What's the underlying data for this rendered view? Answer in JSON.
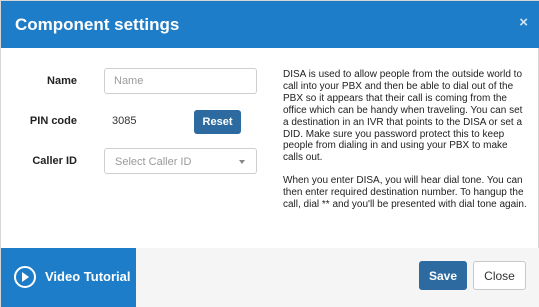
{
  "dialog": {
    "title": "Component settings",
    "close_icon": "×"
  },
  "form": {
    "name_label": "Name",
    "name_placeholder": "Name",
    "name_value": "",
    "pin_label": "PIN code",
    "pin_value": "3085",
    "reset_label": "Reset",
    "caller_id_label": "Caller ID",
    "caller_id_placeholder": "Select Caller ID"
  },
  "info": {
    "paragraph1": "DISA is used to allow people from the outside world to call into your PBX and then be able to dial out of the PBX so it appears that their call is coming from the office which can be handy when traveling. You can set a destination in an IVR that points to the DISA or set a DID. Make sure you password protect this to keep people from dialing in and using your PBX to make calls out.",
    "paragraph2": "When you enter DISA, you will hear dial tone. You can then enter required destination number. To hangup the call, dial ** and you'll be presented with dial tone again."
  },
  "footer": {
    "video_tutorial_label": "Video Tutorial",
    "save_label": "Save",
    "close_label": "Close"
  },
  "colors": {
    "header_bg": "#1e7dc8",
    "primary_button": "#2d6aa0"
  }
}
